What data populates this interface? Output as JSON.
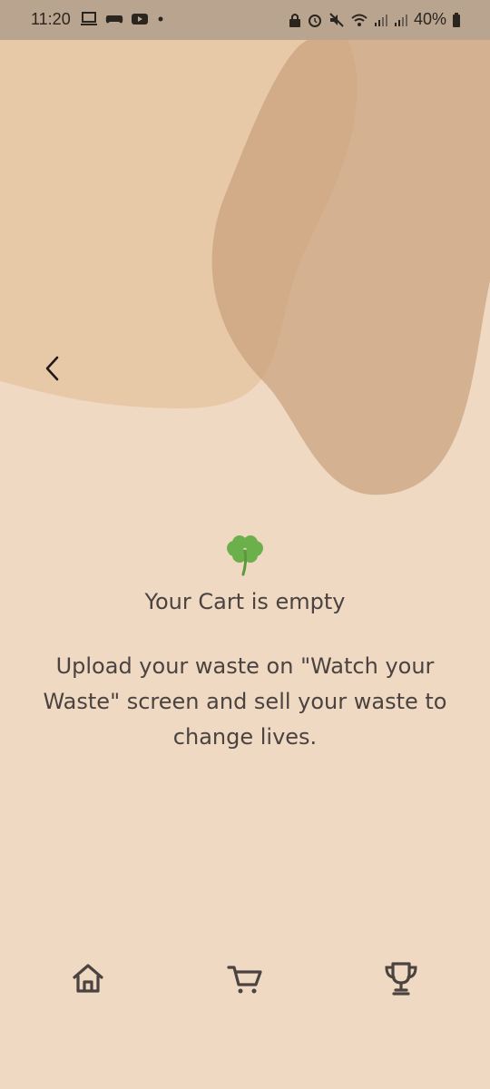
{
  "status_bar": {
    "time": "11:20",
    "battery": "40%",
    "left_icons": [
      "laptop-icon",
      "game-controller-icon",
      "youtube-icon",
      "dot-icon"
    ],
    "right_icons": [
      "lock-icon",
      "alarm-icon",
      "mute-icon",
      "wifi-icon",
      "signal-icon",
      "signal-icon",
      "battery-icon"
    ]
  },
  "header": {
    "back_icon": "chevron-left-icon"
  },
  "empty_state": {
    "icon": "four-leaf-clover-icon",
    "title": "Your Cart is empty",
    "message": "Upload your waste on \"Watch your Waste\" screen and sell your waste to change lives."
  },
  "bottom_nav": {
    "items": [
      {
        "icon": "home-icon"
      },
      {
        "icon": "cart-icon"
      },
      {
        "icon": "trophy-icon"
      }
    ]
  },
  "colors": {
    "background": "#efd9c2",
    "blob_light": "#e6c6a4",
    "blob_dark": "#c9a07a",
    "text": "#4a4340",
    "clover": "#6bb04a",
    "status_bar": "#b9a48f"
  }
}
